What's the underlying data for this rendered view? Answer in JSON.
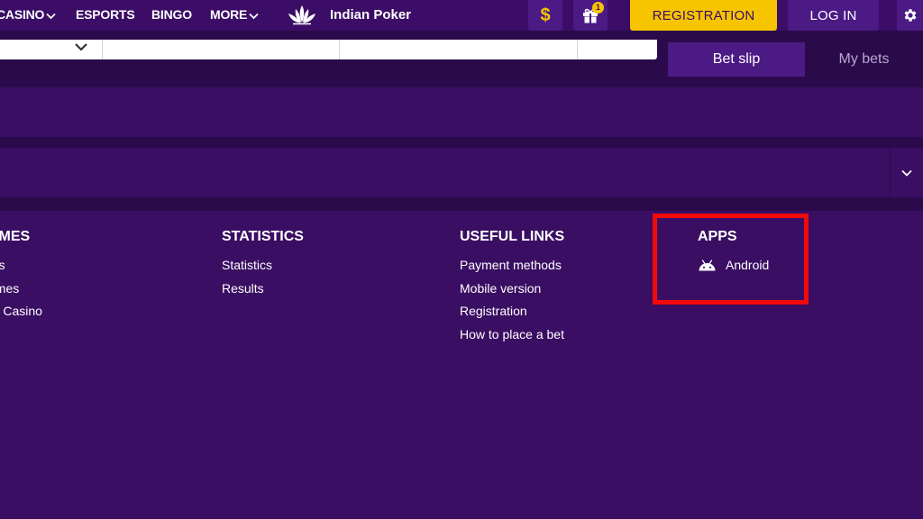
{
  "nav": {
    "casino": "CASINO",
    "esports": "ESPORTS",
    "bingo": "BINGO",
    "more": "MORE",
    "brand": "Indian Poker"
  },
  "header": {
    "dollar_symbol": "$",
    "gift_badge_count": "1",
    "registration_label": "REGISTRATION",
    "login_label": "LOG IN"
  },
  "betslip": {
    "tabs": [
      {
        "label": "Bet slip",
        "active": true
      },
      {
        "label": "My bets",
        "active": false
      }
    ]
  },
  "footer": {
    "games": {
      "title": "AMES",
      "links": [
        "ots",
        "ames",
        "re Casino"
      ]
    },
    "statistics": {
      "title": "STATISTICS",
      "links": [
        "Statistics",
        "Results"
      ]
    },
    "useful_links": {
      "title": "USEFUL LINKS",
      "links": [
        "Payment methods",
        "Mobile version",
        "Registration",
        "How to place a bet"
      ]
    },
    "apps": {
      "title": "APPS",
      "android_label": "Android"
    }
  },
  "icons": {
    "brand": "lotus-icon",
    "dollar": "dollar-icon",
    "gift": "gift-icon",
    "settings": "gear-icon",
    "android": "android-icon",
    "chevron": "chevron-down-icon"
  },
  "colors": {
    "background": "#3a0e63",
    "topbar": "#3b0d66",
    "band_dark": "#2b0a4b",
    "button_purple": "#4c1a85",
    "accent_yellow": "#f7c500",
    "highlight_red": "#f20a0a"
  }
}
